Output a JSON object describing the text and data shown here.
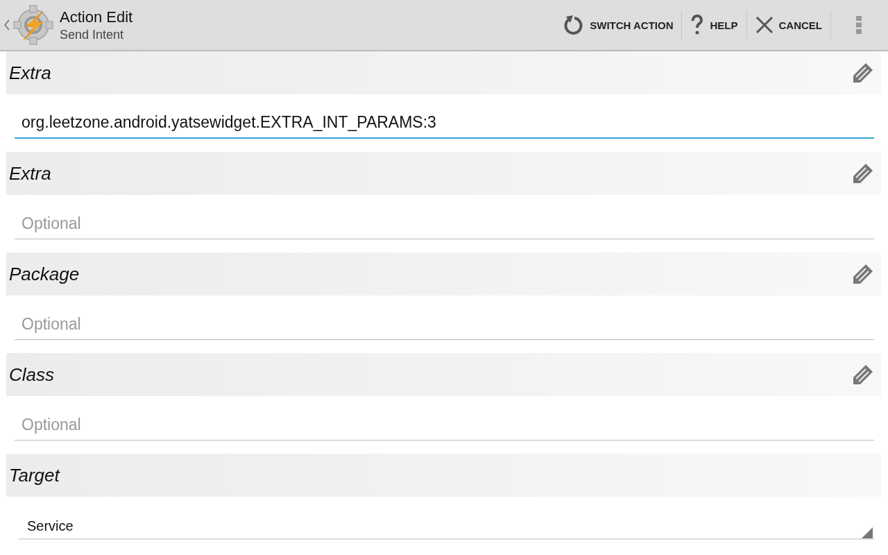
{
  "action_bar": {
    "title": "Action Edit",
    "subtitle": "Send Intent",
    "actions": [
      {
        "label": "SWITCH ACTION",
        "kind": "switch"
      },
      {
        "label": "HELP",
        "kind": "help"
      },
      {
        "label": "CANCEL",
        "kind": "cancel"
      }
    ]
  },
  "sections": [
    {
      "label": "Extra",
      "editable": true,
      "kind": "text",
      "value": "org.leetzone.android.yatsewidget.EXTRA_INT_PARAMS:3",
      "focused": true
    },
    {
      "label": "Extra",
      "editable": true,
      "kind": "text",
      "placeholder": "Optional",
      "focused": false
    },
    {
      "label": "Package",
      "editable": true,
      "kind": "text",
      "placeholder": "Optional",
      "focused": false
    },
    {
      "label": "Class",
      "editable": true,
      "kind": "text",
      "placeholder": "Optional",
      "focused": false
    },
    {
      "label": "Target",
      "editable": false,
      "kind": "spinner",
      "value": "Service"
    }
  ]
}
